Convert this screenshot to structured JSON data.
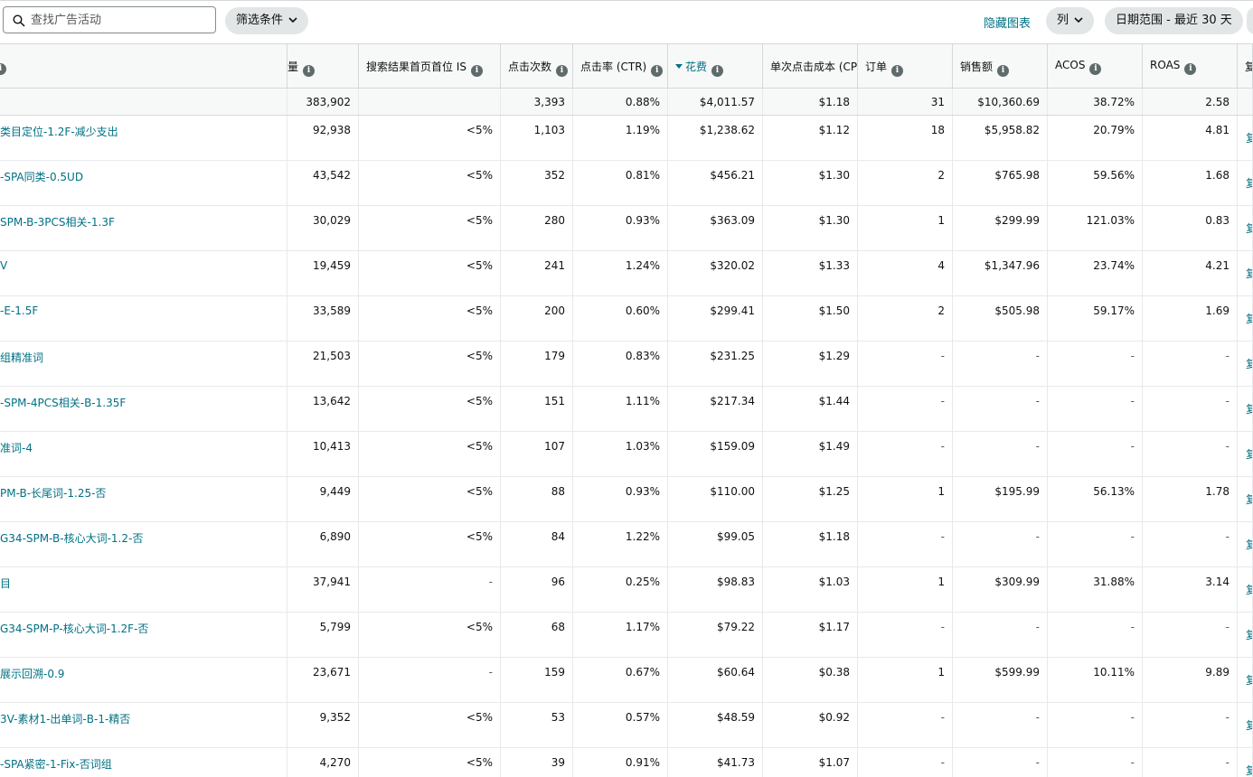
{
  "toolbar": {
    "search_placeholder": "查找广告活动",
    "filter_label": "筛选条件",
    "hide_chart_label": "隐藏图表",
    "columns_label": "列",
    "date_range_label": "日期范围 - 最近 30 天"
  },
  "table": {
    "headers": {
      "first": "",
      "impressions": "ຶ量",
      "top_is": "搜索结果首页首位 IS",
      "clicks": "点击次数",
      "ctr": "点击率 (CTR)",
      "spend": "花费",
      "cpc": "单次点击成本 (CPC)",
      "orders": "订单",
      "sales": "销售额",
      "acos": "ACOS",
      "roas": "ROAS",
      "action": "复"
    },
    "totals": {
      "impressions": "383,902",
      "top_is": "",
      "clicks": "3,393",
      "ctr": "0.88%",
      "spend": "$4,011.57",
      "cpc": "$1.18",
      "orders": "31",
      "sales": "$10,360.69",
      "acos": "38.72%",
      "roas": "2.58"
    },
    "rows": [
      {
        "name": "类目定位-1.2F-减少支出",
        "impressions": "92,938",
        "top_is": "<5%",
        "clicks": "1,103",
        "ctr": "1.19%",
        "spend": "$1,238.62",
        "cpc": "$1.12",
        "orders": "18",
        "sales": "$5,958.82",
        "acos": "20.79%",
        "roas": "4.81",
        "action": "复"
      },
      {
        "name": "-SPA同类-0.5UD",
        "impressions": "43,542",
        "top_is": "<5%",
        "clicks": "352",
        "ctr": "0.81%",
        "spend": "$456.21",
        "cpc": "$1.30",
        "orders": "2",
        "sales": "$765.98",
        "acos": "59.56%",
        "roas": "1.68",
        "action": "复"
      },
      {
        "name": "SPM-B-3PCS相关-1.3F",
        "impressions": "30,029",
        "top_is": "<5%",
        "clicks": "280",
        "ctr": "0.93%",
        "spend": "$363.09",
        "cpc": "$1.30",
        "orders": "1",
        "sales": "$299.99",
        "acos": "121.03%",
        "roas": "0.83",
        "action": "复"
      },
      {
        "name": "V",
        "impressions": "19,459",
        "top_is": "<5%",
        "clicks": "241",
        "ctr": "1.24%",
        "spend": "$320.02",
        "cpc": "$1.33",
        "orders": "4",
        "sales": "$1,347.96",
        "acos": "23.74%",
        "roas": "4.21",
        "action": "复"
      },
      {
        "name": "-E-1.5F",
        "impressions": "33,589",
        "top_is": "<5%",
        "clicks": "200",
        "ctr": "0.60%",
        "spend": "$299.41",
        "cpc": "$1.50",
        "orders": "2",
        "sales": "$505.98",
        "acos": "59.17%",
        "roas": "1.69",
        "action": "复"
      },
      {
        "name": "组精准词",
        "impressions": "21,503",
        "top_is": "<5%",
        "clicks": "179",
        "ctr": "0.83%",
        "spend": "$231.25",
        "cpc": "$1.29",
        "orders": "-",
        "sales": "-",
        "acos": "-",
        "roas": "-",
        "action": "复"
      },
      {
        "name": "-SPM-4PCS相关-B-1.35F",
        "impressions": "13,642",
        "top_is": "<5%",
        "clicks": "151",
        "ctr": "1.11%",
        "spend": "$217.34",
        "cpc": "$1.44",
        "orders": "-",
        "sales": "-",
        "acos": "-",
        "roas": "-",
        "action": "复"
      },
      {
        "name": "准词-4",
        "impressions": "10,413",
        "top_is": "<5%",
        "clicks": "107",
        "ctr": "1.03%",
        "spend": "$159.09",
        "cpc": "$1.49",
        "orders": "-",
        "sales": "-",
        "acos": "-",
        "roas": "-",
        "action": "复"
      },
      {
        "name": "PM-B-长尾词-1.25-否",
        "impressions": "9,449",
        "top_is": "<5%",
        "clicks": "88",
        "ctr": "0.93%",
        "spend": "$110.00",
        "cpc": "$1.25",
        "orders": "1",
        "sales": "$195.99",
        "acos": "56.13%",
        "roas": "1.78",
        "action": "复"
      },
      {
        "name": "G34-SPM-B-核心大词-1.2-否",
        "impressions": "6,890",
        "top_is": "<5%",
        "clicks": "84",
        "ctr": "1.22%",
        "spend": "$99.05",
        "cpc": "$1.18",
        "orders": "-",
        "sales": "-",
        "acos": "-",
        "roas": "-",
        "action": "复"
      },
      {
        "name": "目",
        "impressions": "37,941",
        "top_is": "-",
        "clicks": "96",
        "ctr": "0.25%",
        "spend": "$98.83",
        "cpc": "$1.03",
        "orders": "1",
        "sales": "$309.99",
        "acos": "31.88%",
        "roas": "3.14",
        "action": "复"
      },
      {
        "name": "G34-SPM-P-核心大词-1.2F-否",
        "impressions": "5,799",
        "top_is": "<5%",
        "clicks": "68",
        "ctr": "1.17%",
        "spend": "$79.22",
        "cpc": "$1.17",
        "orders": "-",
        "sales": "-",
        "acos": "-",
        "roas": "-",
        "action": "复"
      },
      {
        "name": "展示回溯-0.9",
        "impressions": "23,671",
        "top_is": "-",
        "clicks": "159",
        "ctr": "0.67%",
        "spend": "$60.64",
        "cpc": "$0.38",
        "orders": "1",
        "sales": "$599.99",
        "acos": "10.11%",
        "roas": "9.89",
        "action": "复"
      },
      {
        "name": "3V-素材1-出单词-B-1-精否",
        "impressions": "9,352",
        "top_is": "<5%",
        "clicks": "53",
        "ctr": "0.57%",
        "spend": "$48.59",
        "cpc": "$0.92",
        "orders": "-",
        "sales": "-",
        "acos": "-",
        "roas": "-",
        "action": "复"
      },
      {
        "name": "-SPA紧密-1-Fix-否词组",
        "impressions": "4,270",
        "top_is": "<5%",
        "clicks": "39",
        "ctr": "0.91%",
        "spend": "$41.73",
        "cpc": "$1.07",
        "orders": "-",
        "sales": "-",
        "acos": "-",
        "roas": "-",
        "action": "复"
      }
    ]
  }
}
